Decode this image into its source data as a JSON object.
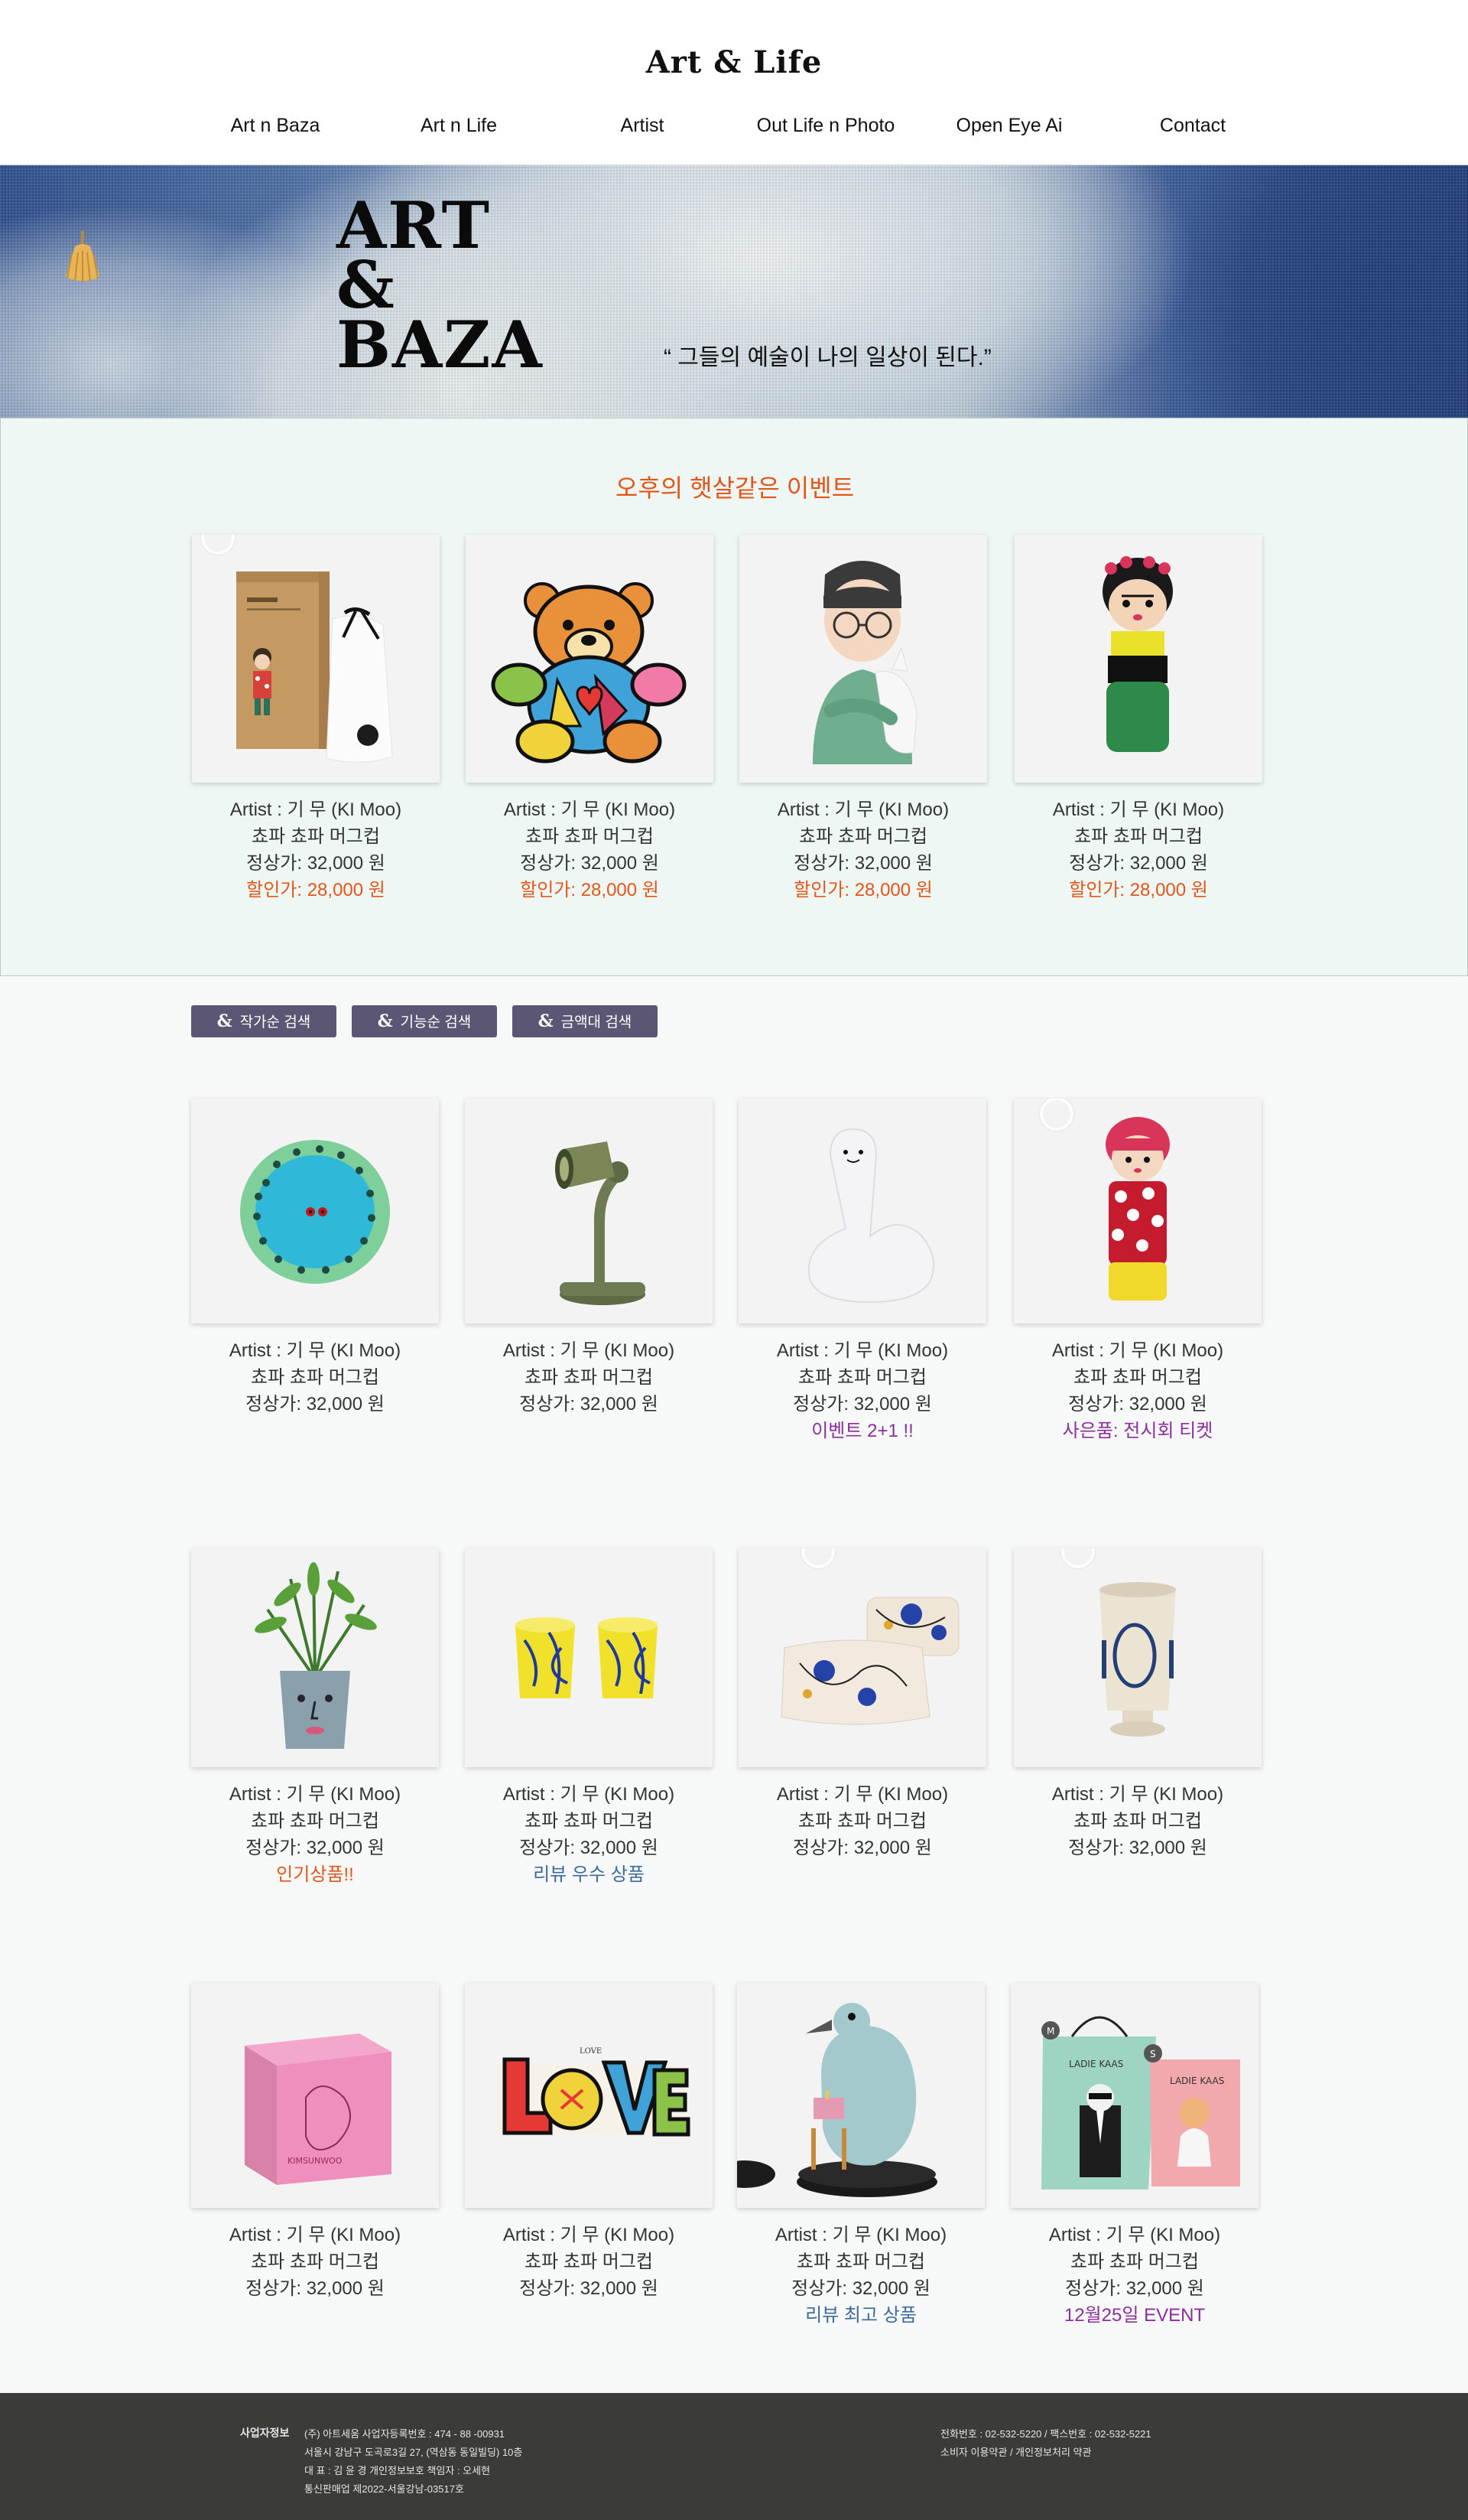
{
  "header": {
    "logo": "Art & Life",
    "nav": [
      "Art n Baza",
      "Art n Life",
      "Artist",
      "Out Life n Photo",
      "Open Eye Ai",
      "Contact"
    ]
  },
  "hero": {
    "title_line1": "ART",
    "title_line2": "&",
    "title_line3": "BAZA",
    "quote": "“ 그들의 예술이 나의 일상이 된다.”"
  },
  "event": {
    "title": "오후의 햇살같은 이벤트",
    "products": [
      {
        "artist": "Artist :  기 무 (KI Moo)",
        "name": "쵸파 쵸파  머그컵",
        "price": "정상가: 32,000 원",
        "sale": "할인가: 28,000 원",
        "icon": "packaged-doll-icon"
      },
      {
        "artist": "Artist :  기 무 (KI Moo)",
        "name": "쵸파 쵸파  머그컵",
        "price": "정상가: 32,000 원",
        "sale": "할인가: 28,000 원",
        "icon": "pop-art-bear-icon"
      },
      {
        "artist": "Artist :  기 무 (KI Moo)",
        "name": "쵸파 쵸파  머그컵",
        "price": "정상가: 32,000 원",
        "sale": "할인가: 28,000 원",
        "icon": "figurine-boy-icon"
      },
      {
        "artist": "Artist :  기 무 (KI Moo)",
        "name": "쵸파 쵸파  머그컵",
        "price": "정상가: 32,000 원",
        "sale": "할인가: 28,000 원",
        "icon": "kokeshi-doll-icon"
      }
    ]
  },
  "search_buttons": [
    {
      "amp": "&",
      "label": "작가순 검색"
    },
    {
      "amp": "&",
      "label": "기능순 검색"
    },
    {
      "amp": "&",
      "label": "금액대 검색"
    }
  ],
  "products_row1": [
    {
      "artist": "Artist :  기 무 (KI Moo)",
      "name": "쵸파 쵸파  머그컵",
      "price": "정상가: 32,000 원",
      "note": "",
      "icon": "plate-icon"
    },
    {
      "artist": "Artist :  기 무 (KI Moo)",
      "name": "쵸파 쵸파  머그컵",
      "price": "정상가: 32,000 원",
      "note": "",
      "icon": "desk-lamp-icon"
    },
    {
      "artist": "Artist :  기 무 (KI Moo)",
      "name": "쵸파 쵸파  머그컵",
      "price": "정상가: 32,000 원",
      "note": "이벤트 2+1 !!",
      "icon": "swan-icon"
    },
    {
      "artist": "Artist :  기 무 (KI Moo)",
      "name": "쵸파 쵸파  머그컵",
      "price": "정상가: 32,000 원",
      "note": "사은품: 전시회 티켓",
      "icon": "polka-doll-icon"
    }
  ],
  "products_row2": [
    {
      "artist": "Artist :  기 무 (KI Moo)",
      "name": "쵸파 쵸파  머그컵",
      "price": "정상가: 32,000 원",
      "note": "인기상품!!",
      "icon": "plant-pot-icon"
    },
    {
      "artist": "Artist :  기 무 (KI Moo)",
      "name": "쵸파 쵸파  머그컵",
      "price": "정상가: 32,000 원",
      "note": "리뷰 우수 상품",
      "icon": "yellow-cups-icon"
    },
    {
      "artist": "Artist :  기 무 (KI Moo)",
      "name": "쵸파 쵸파  머그컵",
      "price": "정상가: 32,000 원",
      "note": "",
      "icon": "pouches-icon"
    },
    {
      "artist": "Artist :  기 무 (KI Moo)",
      "name": "쵸파 쵸파  머그컵",
      "price": "정상가: 32,000 원",
      "note": "",
      "icon": "ceramic-cup-icon"
    }
  ],
  "products_row3": [
    {
      "artist": "Artist :  기 무 (KI Moo)",
      "name": "쵸파 쵸파  머그컵",
      "price": "정상가: 32,000 원",
      "note": "",
      "icon": "pink-box-icon",
      "box_text": "KIMSUNWOO"
    },
    {
      "artist": "Artist :  기 무 (KI Moo)",
      "name": "쵸파 쵸파  머그컵",
      "price": "정상가: 32,000 원",
      "note": "",
      "icon": "love-sculpture-icon",
      "sculpture_text": "LOVE"
    },
    {
      "artist": "Artist :  기 무 (KI Moo)",
      "name": "쵸파 쵸파  머그컵",
      "price": "정상가: 32,000 원",
      "note": "리뷰 최고 상품",
      "icon": "dodo-figurine-icon"
    },
    {
      "artist": "Artist :  기 무 (KI Moo)",
      "name": "쵸파 쵸파  머그컵",
      "price": "정상가: 32,000 원",
      "note": "12월25일 EVENT",
      "icon": "gift-bags-icon",
      "bag_text_1": "LADIE KAAS",
      "bag_text_2": "LADIE KAAS",
      "size_m": "M",
      "size_s": "S"
    }
  ],
  "footer": {
    "label": "사업자정보",
    "line1": "(주) 아트세움      사업자등록번호 : 474 - 88 -00931",
    "line2": "서울시 강남구 도곡로3길 27, (역삼동 동일빌딩) 10층",
    "line3": "대 표 : 김 윤 경     개인정보보호 책임자 : 오세현",
    "line4": "통신판매업 제2022-서울강남-03517호",
    "contact1": "전화번호 : 02-532-5220   /   팩스번호 : 02-532-5221",
    "contact2": "소비자 이용약관    /    개인정보처리 약관"
  },
  "colors": {
    "accent_orange": "#e2561a",
    "accent_purple": "#8a2f9c",
    "accent_blue": "#3d6a9c",
    "button_bg": "#5c5675",
    "footer_bg": "#3b3b38",
    "event_bg": "#eef7f4"
  }
}
